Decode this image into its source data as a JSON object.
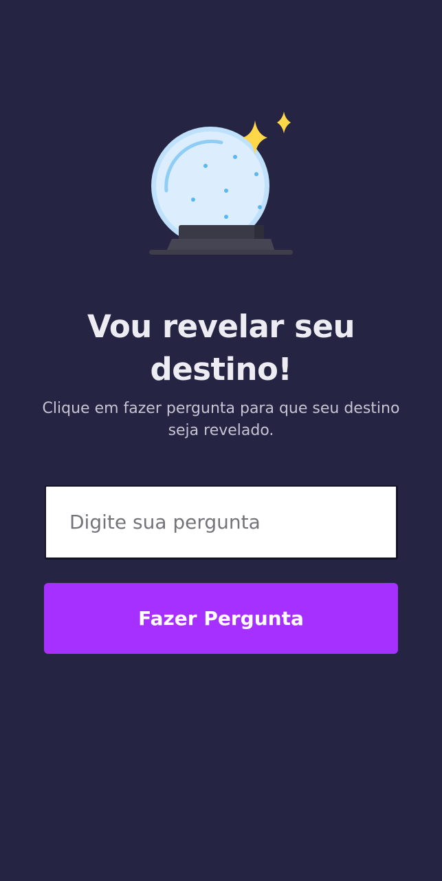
{
  "hero": {
    "illustration": "crystal-ball-icon",
    "title": "Vou revelar seu destino!",
    "subtitle": "Clique em fazer pergunta para que seu destino seja revelado."
  },
  "form": {
    "question_placeholder": "Digite sua pergunta",
    "question_value": "",
    "submit_label": "Fazer Pergunta"
  },
  "colors": {
    "background": "#262443",
    "accent": "#a530ff",
    "title": "#ececf2",
    "subtitle": "#c6c5d4",
    "sparkle": "#ffe14d",
    "globe": "#dbeeff"
  }
}
